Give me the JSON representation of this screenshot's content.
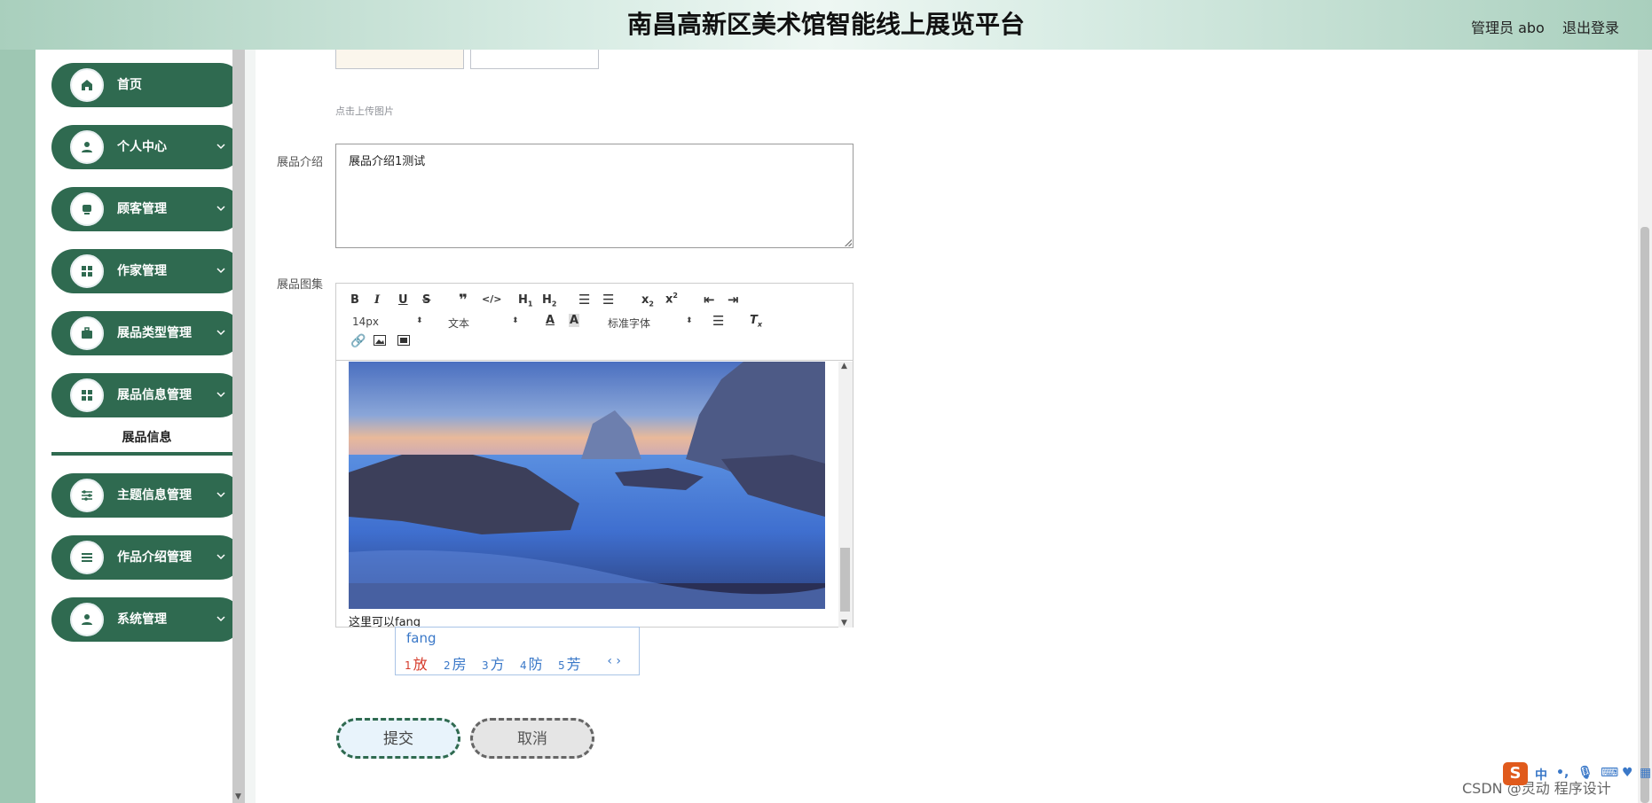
{
  "header": {
    "title": "南昌高新区美术馆智能线上展览平台",
    "user": "管理员 abo",
    "logout": "退出登录"
  },
  "sidebar": {
    "items": [
      {
        "label": "首页",
        "icon": "home-icon"
      },
      {
        "label": "个人中心",
        "icon": "user-icon"
      },
      {
        "label": "顾客管理",
        "icon": "customer-icon"
      },
      {
        "label": "作家管理",
        "icon": "grid-icon"
      },
      {
        "label": "展品类型管理",
        "icon": "briefcase-icon"
      },
      {
        "label": "展品信息管理",
        "icon": "grid-icon"
      },
      {
        "label": "主题信息管理",
        "icon": "sliders-icon"
      },
      {
        "label": "作品介绍管理",
        "icon": "list-icon"
      },
      {
        "label": "系统管理",
        "icon": "user-icon"
      }
    ],
    "submenu_active": "展品信息"
  },
  "form": {
    "upload_hint": "点击上传图片",
    "intro_label": "展品介绍",
    "intro_value": "展品介绍1测试",
    "gallery_label": "展品图集"
  },
  "editor": {
    "font_size": "14px",
    "text_type": "文本",
    "font_family": "标准字体",
    "content_text": "这里可以fang"
  },
  "ime": {
    "pinyin": "fang",
    "candidates": [
      {
        "n": "1",
        "c": "放"
      },
      {
        "n": "2",
        "c": "房"
      },
      {
        "n": "3",
        "c": "方"
      },
      {
        "n": "4",
        "c": "防"
      },
      {
        "n": "5",
        "c": "芳"
      }
    ]
  },
  "buttons": {
    "submit": "提交",
    "cancel": "取消"
  },
  "watermark": "CSDN @灵动 程序设计",
  "tray": {
    "s": "S",
    "zh": "中"
  },
  "colors": {
    "primary": "#2f6a50",
    "header_gradient_edge": "#a9cfbd"
  }
}
